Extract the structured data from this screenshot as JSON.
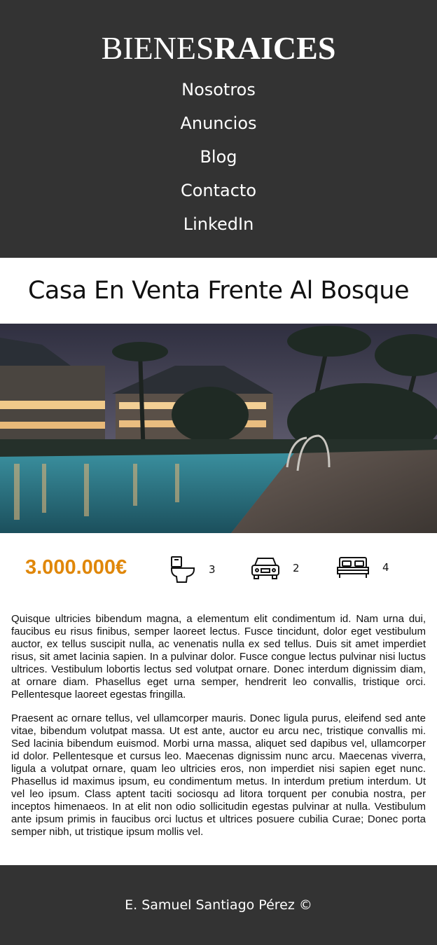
{
  "header": {
    "logo_light": "BIENES",
    "logo_bold": "RAICES",
    "nav": [
      "Nosotros",
      "Anuncios",
      "Blog",
      "Contacto",
      "LinkedIn"
    ]
  },
  "listing": {
    "title": "Casa En Venta Frente Al Bosque",
    "price": "3.000.000€",
    "features": {
      "wc": "3",
      "parking": "2",
      "bedrooms": "4"
    },
    "paragraphs": [
      "Quisque ultricies bibendum magna, a elementum elit condimentum id. Nam urna dui, faucibus eu risus finibus, semper laoreet lectus. Fusce tincidunt, dolor eget vestibulum auctor, ex tellus suscipit nulla, ac venenatis nulla ex sed tellus. Duis sit amet imperdiet risus, sit amet lacinia sapien. In a pulvinar dolor. Fusce congue lectus pulvinar nisi luctus ultrices. Vestibulum lobortis lectus sed volutpat ornare. Donec interdum dignissim diam, at ornare diam. Phasellus eget urna semper, hendrerit leo convallis, tristique orci. Pellentesque laoreet egestas fringilla.",
      "Praesent ac ornare tellus, vel ullamcorper mauris. Donec ligula purus, eleifend sed ante vitae, bibendum volutpat massa. Ut est ante, auctor eu arcu nec, tristique convallis mi. Sed lacinia bibendum euismod. Morbi urna massa, aliquet sed dapibus vel, ullamcorper id dolor. Pellentesque et cursus leo. Maecenas dignissim nunc arcu. Maecenas viverra, ligula a volutpat ornare, quam leo ultricies eros, non imperdiet nisi sapien eget nunc. Phasellus id maximus ipsum, eu condimentum metus. In interdum pretium interdum. Ut vel leo ipsum. Class aptent taciti sociosqu ad litora torquent per conubia nostra, per inceptos himenaeos. In at elit non odio sollicitudin egestas pulvinar at nulla. Vestibulum ante ipsum primis in faucibus orci luctus et ultrices posuere cubilia Curae; Donec porta semper nibh, ut tristique ipsum mollis vel."
    ]
  },
  "footer": {
    "text": "E. Samuel Santiago Pérez ©"
  },
  "colors": {
    "header_bg": "#333333",
    "price": "#e08709",
    "footer_bg": "#333333"
  },
  "icons": [
    "toilet-icon",
    "car-icon",
    "bed-icon"
  ]
}
